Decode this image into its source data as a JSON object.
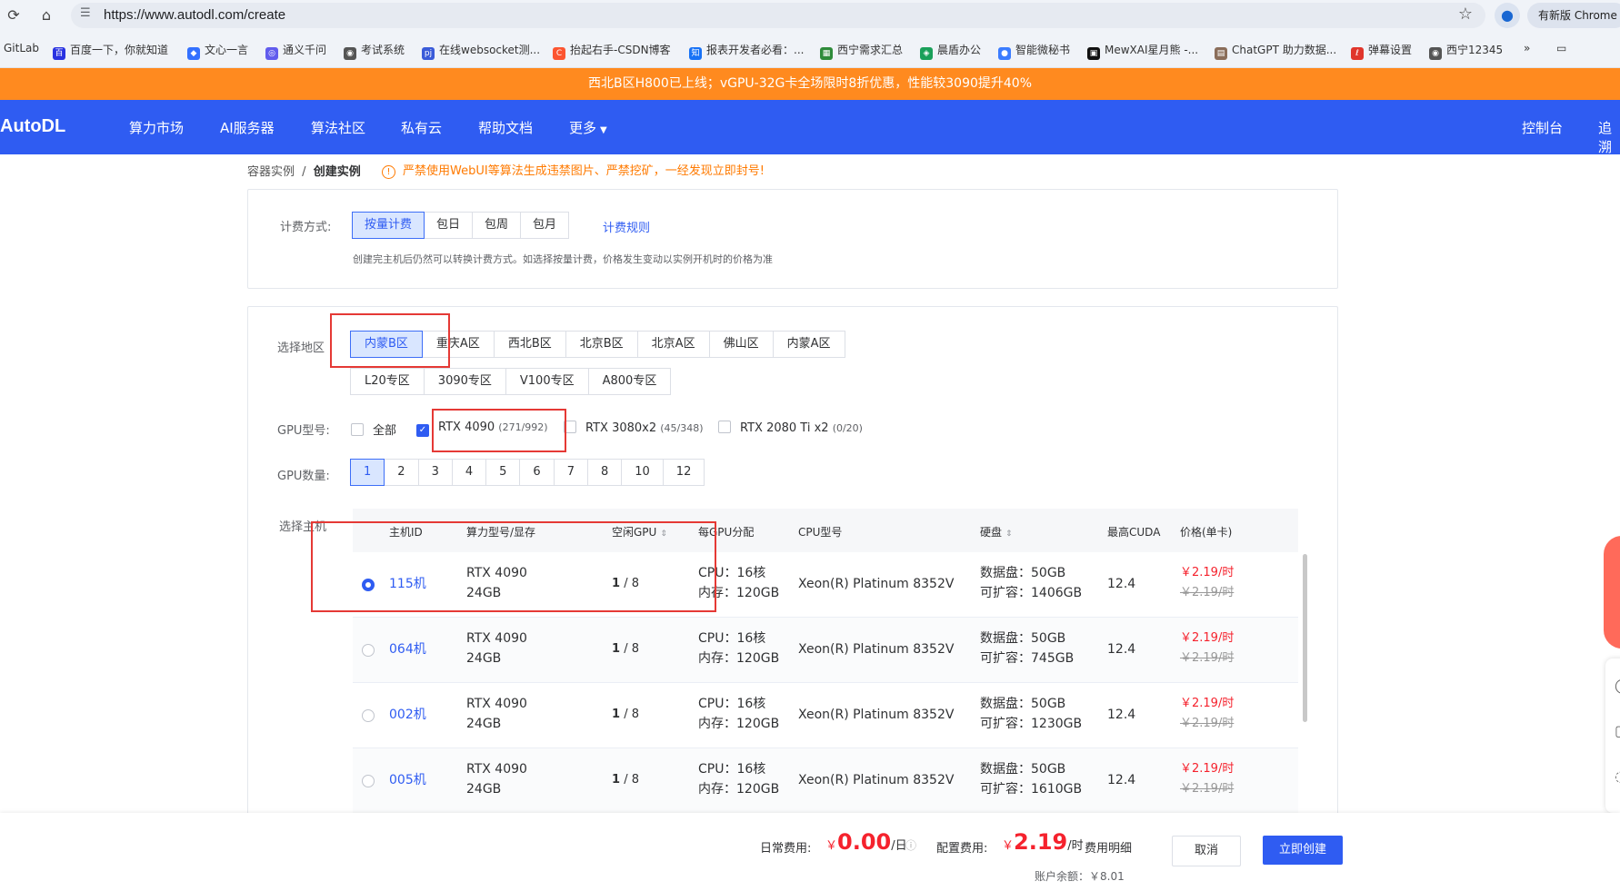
{
  "browser": {
    "url": "https://www.autodl.com/create",
    "update_label": "有新版 Chrome",
    "bookmarks": [
      "GitLab",
      "百度一下，你就知道",
      "文心一言",
      "通义千问",
      "考试系统",
      "在线websocket测...",
      "抬起右手-CSDN博客",
      "报表开发者必看：...",
      "西宁需求汇总",
      "晨盾办公",
      "智能微秘书",
      "MewXAI星月熊 -...",
      "ChatGPT 助力数据...",
      "弹幕设置",
      "西宁12345"
    ]
  },
  "announcement": "西北B区H800已上线；vGPU-32G卡全场限时8折优惠，性能较3090提升40%",
  "nav": {
    "logo": "AutoDL",
    "items": [
      "算力市场",
      "AI服务器",
      "算法社区",
      "私有云",
      "帮助文档",
      "更多"
    ],
    "console": "控制台",
    "extra": "追溯"
  },
  "breadcrumb": {
    "parent": "容器实例",
    "sep": "/",
    "current": "创建实例"
  },
  "warning": "严禁使用WebUI等算法生成违禁图片、严禁挖矿，一经发现立即封号!",
  "billing": {
    "label": "计费方式:",
    "options": [
      "按量计费",
      "包日",
      "包周",
      "包月"
    ],
    "selected": "按量计费",
    "rule_link": "计费规则",
    "note": "创建完主机后仍然可以转换计费方式。如选择按量计费，价格发生变动以实例开机时的价格为准"
  },
  "region": {
    "label": "选择地区",
    "row1": [
      "内蒙B区",
      "重庆A区",
      "西北B区",
      "北京B区",
      "北京A区",
      "佛山区",
      "内蒙A区"
    ],
    "row2": [
      "L20专区",
      "3090专区",
      "V100专区",
      "A800专区"
    ],
    "selected": "内蒙B区"
  },
  "gpu_model": {
    "label": "GPU型号:",
    "options": [
      {
        "name": "全部",
        "count": "",
        "checked": false
      },
      {
        "name": "RTX 4090",
        "count": "(271/992)",
        "checked": true
      },
      {
        "name": "RTX 3080x2",
        "count": "(45/348)",
        "checked": false
      },
      {
        "name": "RTX 2080 Ti x2",
        "count": "(0/20)",
        "checked": false
      }
    ]
  },
  "gpu_count": {
    "label": "GPU数量:",
    "options": [
      "1",
      "2",
      "3",
      "4",
      "5",
      "6",
      "7",
      "8",
      "10",
      "12"
    ],
    "selected": "1"
  },
  "host": {
    "label": "选择主机",
    "headers": [
      "主机ID",
      "算力型号/显存",
      "空闲GPU",
      "每GPU分配",
      "CPU型号",
      "硬盘",
      "最高CUDA",
      "价格(单卡)"
    ],
    "rows": [
      {
        "id": "115机",
        "gpu": "RTX 4090",
        "mem": "24GB",
        "free": "1",
        "total": "/ 8",
        "cpu": "CPU：16核",
        "ram": "内存：120GB",
        "cpu_model": "Xeon(R) Platinum 8352V",
        "disk": "数据盘：50GB",
        "expand": "可扩容：1406GB",
        "cuda": "12.4",
        "price": "￥2.19/时",
        "orig": "￥2.19/时",
        "selected": true
      },
      {
        "id": "064机",
        "gpu": "RTX 4090",
        "mem": "24GB",
        "free": "1",
        "total": "/ 8",
        "cpu": "CPU：16核",
        "ram": "内存：120GB",
        "cpu_model": "Xeon(R) Platinum 8352V",
        "disk": "数据盘：50GB",
        "expand": "可扩容：745GB",
        "cuda": "12.4",
        "price": "￥2.19/时",
        "orig": "￥2.19/时",
        "selected": false
      },
      {
        "id": "002机",
        "gpu": "RTX 4090",
        "mem": "24GB",
        "free": "1",
        "total": "/ 8",
        "cpu": "CPU：16核",
        "ram": "内存：120GB",
        "cpu_model": "Xeon(R) Platinum 8352V",
        "disk": "数据盘：50GB",
        "expand": "可扩容：1230GB",
        "cuda": "12.4",
        "price": "￥2.19/时",
        "orig": "￥2.19/时",
        "selected": false
      },
      {
        "id": "005机",
        "gpu": "RTX 4090",
        "mem": "24GB",
        "free": "1",
        "total": "/ 8",
        "cpu": "CPU：16核",
        "ram": "内存：120GB",
        "cpu_model": "Xeon(R) Platinum 8352V",
        "disk": "数据盘：50GB",
        "expand": "可扩容：1610GB",
        "cuda": "12.4",
        "price": "￥2.19/时",
        "orig": "￥2.19/时",
        "selected": false
      }
    ]
  },
  "footer": {
    "daily_label": "日常费用:",
    "daily_currency": "￥",
    "daily_value": "0.00",
    "daily_unit": "/日",
    "config_label": "配置费用:",
    "config_currency": "￥",
    "config_value": "2.19",
    "config_unit": "/时",
    "detail_link": "费用明细",
    "balance": "账户余额：￥8.01",
    "cancel": "取消",
    "create": "立即创建"
  },
  "colors": {
    "brand_blue": "#2f5cf2",
    "announce_orange": "#ff8a1f",
    "price_red": "#f5222d",
    "highlight_red": "#e53935"
  }
}
